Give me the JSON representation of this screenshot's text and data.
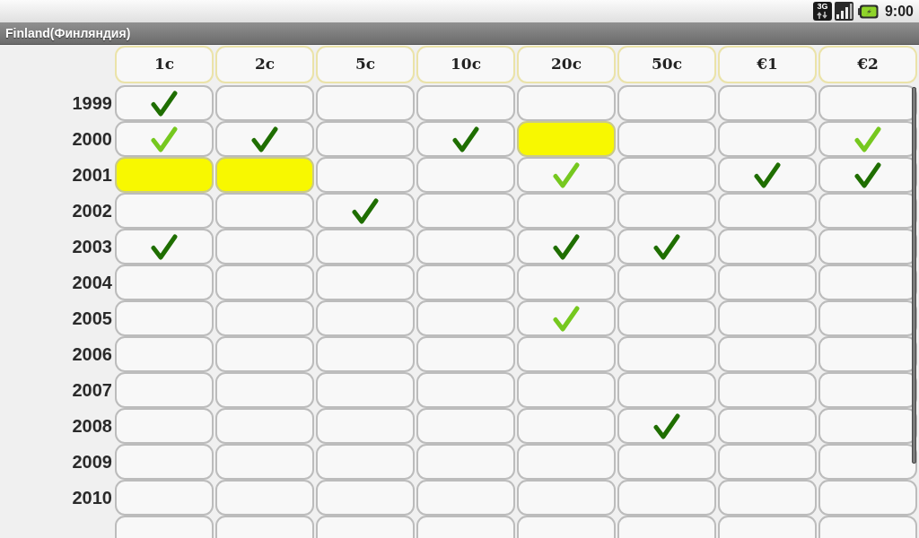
{
  "status_bar": {
    "network": "3G",
    "time": "9:00"
  },
  "title": "Finland(Финляндия)",
  "columns": [
    "1c",
    "2c",
    "5c",
    "10c",
    "20c",
    "50c",
    "€1",
    "€2"
  ],
  "rows": [
    {
      "year": "1999",
      "cells": [
        {
          "checked": true,
          "highlighted": false,
          "color": "#1f6e00"
        },
        {
          "checked": false,
          "highlighted": false
        },
        {
          "checked": false,
          "highlighted": false
        },
        {
          "checked": false,
          "highlighted": false
        },
        {
          "checked": false,
          "highlighted": false
        },
        {
          "checked": false,
          "highlighted": false
        },
        {
          "checked": false,
          "highlighted": false
        },
        {
          "checked": false,
          "highlighted": false
        }
      ]
    },
    {
      "year": "2000",
      "cells": [
        {
          "checked": true,
          "highlighted": false,
          "color": "#76c81f"
        },
        {
          "checked": true,
          "highlighted": false,
          "color": "#1f6e00"
        },
        {
          "checked": false,
          "highlighted": false
        },
        {
          "checked": true,
          "highlighted": false,
          "color": "#1f6e00"
        },
        {
          "checked": false,
          "highlighted": true
        },
        {
          "checked": false,
          "highlighted": false
        },
        {
          "checked": false,
          "highlighted": false
        },
        {
          "checked": true,
          "highlighted": false,
          "color": "#76c81f"
        }
      ]
    },
    {
      "year": "2001",
      "cells": [
        {
          "checked": false,
          "highlighted": true
        },
        {
          "checked": false,
          "highlighted": true
        },
        {
          "checked": false,
          "highlighted": false
        },
        {
          "checked": false,
          "highlighted": false
        },
        {
          "checked": true,
          "highlighted": false,
          "color": "#76c81f"
        },
        {
          "checked": false,
          "highlighted": false
        },
        {
          "checked": true,
          "highlighted": false,
          "color": "#1f6e00"
        },
        {
          "checked": true,
          "highlighted": false,
          "color": "#1f6e00"
        }
      ]
    },
    {
      "year": "2002",
      "cells": [
        {
          "checked": false,
          "highlighted": false
        },
        {
          "checked": false,
          "highlighted": false
        },
        {
          "checked": true,
          "highlighted": false,
          "color": "#1f6e00"
        },
        {
          "checked": false,
          "highlighted": false
        },
        {
          "checked": false,
          "highlighted": false
        },
        {
          "checked": false,
          "highlighted": false
        },
        {
          "checked": false,
          "highlighted": false
        },
        {
          "checked": false,
          "highlighted": false
        }
      ]
    },
    {
      "year": "2003",
      "cells": [
        {
          "checked": true,
          "highlighted": false,
          "color": "#1f6e00"
        },
        {
          "checked": false,
          "highlighted": false
        },
        {
          "checked": false,
          "highlighted": false
        },
        {
          "checked": false,
          "highlighted": false
        },
        {
          "checked": true,
          "highlighted": false,
          "color": "#1f6e00"
        },
        {
          "checked": true,
          "highlighted": false,
          "color": "#1f6e00"
        },
        {
          "checked": false,
          "highlighted": false
        },
        {
          "checked": false,
          "highlighted": false
        }
      ]
    },
    {
      "year": "2004",
      "cells": [
        {
          "checked": false,
          "highlighted": false
        },
        {
          "checked": false,
          "highlighted": false
        },
        {
          "checked": false,
          "highlighted": false
        },
        {
          "checked": false,
          "highlighted": false
        },
        {
          "checked": false,
          "highlighted": false
        },
        {
          "checked": false,
          "highlighted": false
        },
        {
          "checked": false,
          "highlighted": false
        },
        {
          "checked": false,
          "highlighted": false
        }
      ]
    },
    {
      "year": "2005",
      "cells": [
        {
          "checked": false,
          "highlighted": false
        },
        {
          "checked": false,
          "highlighted": false
        },
        {
          "checked": false,
          "highlighted": false
        },
        {
          "checked": false,
          "highlighted": false
        },
        {
          "checked": true,
          "highlighted": false,
          "color": "#76c81f"
        },
        {
          "checked": false,
          "highlighted": false
        },
        {
          "checked": false,
          "highlighted": false
        },
        {
          "checked": false,
          "highlighted": false
        }
      ]
    },
    {
      "year": "2006",
      "cells": [
        {
          "checked": false,
          "highlighted": false
        },
        {
          "checked": false,
          "highlighted": false
        },
        {
          "checked": false,
          "highlighted": false
        },
        {
          "checked": false,
          "highlighted": false
        },
        {
          "checked": false,
          "highlighted": false
        },
        {
          "checked": false,
          "highlighted": false
        },
        {
          "checked": false,
          "highlighted": false
        },
        {
          "checked": false,
          "highlighted": false
        }
      ]
    },
    {
      "year": "2007",
      "cells": [
        {
          "checked": false,
          "highlighted": false
        },
        {
          "checked": false,
          "highlighted": false
        },
        {
          "checked": false,
          "highlighted": false
        },
        {
          "checked": false,
          "highlighted": false
        },
        {
          "checked": false,
          "highlighted": false
        },
        {
          "checked": false,
          "highlighted": false
        },
        {
          "checked": false,
          "highlighted": false
        },
        {
          "checked": false,
          "highlighted": false
        }
      ]
    },
    {
      "year": "2008",
      "cells": [
        {
          "checked": false,
          "highlighted": false
        },
        {
          "checked": false,
          "highlighted": false
        },
        {
          "checked": false,
          "highlighted": false
        },
        {
          "checked": false,
          "highlighted": false
        },
        {
          "checked": false,
          "highlighted": false
        },
        {
          "checked": true,
          "highlighted": false,
          "color": "#1f6e00"
        },
        {
          "checked": false,
          "highlighted": false
        },
        {
          "checked": false,
          "highlighted": false
        }
      ]
    },
    {
      "year": "2009",
      "cells": [
        {
          "checked": false,
          "highlighted": false
        },
        {
          "checked": false,
          "highlighted": false
        },
        {
          "checked": false,
          "highlighted": false
        },
        {
          "checked": false,
          "highlighted": false
        },
        {
          "checked": false,
          "highlighted": false
        },
        {
          "checked": false,
          "highlighted": false
        },
        {
          "checked": false,
          "highlighted": false
        },
        {
          "checked": false,
          "highlighted": false
        }
      ]
    },
    {
      "year": "2010",
      "cells": [
        {
          "checked": false,
          "highlighted": false
        },
        {
          "checked": false,
          "highlighted": false
        },
        {
          "checked": false,
          "highlighted": false
        },
        {
          "checked": false,
          "highlighted": false
        },
        {
          "checked": false,
          "highlighted": false
        },
        {
          "checked": false,
          "highlighted": false
        },
        {
          "checked": false,
          "highlighted": false
        },
        {
          "checked": false,
          "highlighted": false
        }
      ]
    },
    {
      "cells": [
        {
          "checked": false,
          "highlighted": false
        },
        {
          "checked": false,
          "highlighted": false
        },
        {
          "checked": false,
          "highlighted": false
        },
        {
          "checked": false,
          "highlighted": false
        },
        {
          "checked": false,
          "highlighted": false
        },
        {
          "checked": false,
          "highlighted": false
        },
        {
          "checked": false,
          "highlighted": false
        },
        {
          "checked": false,
          "highlighted": false
        }
      ]
    }
  ]
}
